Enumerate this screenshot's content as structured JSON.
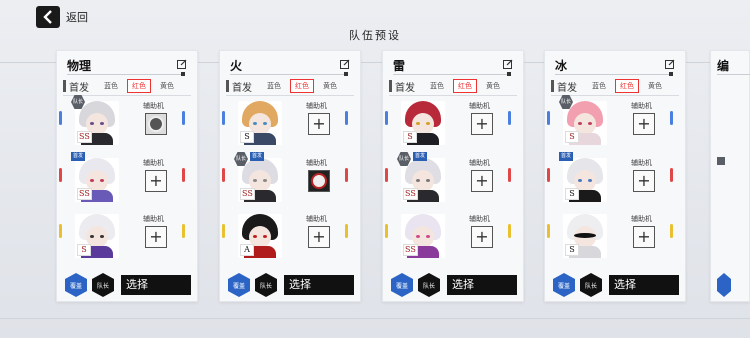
{
  "header": {
    "back_label": "返回",
    "title": "队伍预设"
  },
  "common": {
    "team_label": "首发",
    "support_label": "辅助机",
    "badge_leader": "队长",
    "badge_first": "首发"
  },
  "cards": [
    {
      "title": "物理",
      "tabs": [
        "蓝色",
        "红色",
        "黄色"
      ],
      "active_tab": 1,
      "bottom": {
        "overlay": "覆盖",
        "leader": "队长",
        "select": "选择"
      },
      "members": [
        {
          "rank": "SS",
          "support": "filled"
        },
        {
          "rank": "SS",
          "support": "empty"
        },
        {
          "rank": "S",
          "support": "empty"
        }
      ]
    },
    {
      "title": "火",
      "tabs": [
        "蓝色",
        "红色",
        "黄色"
      ],
      "active_tab": 1,
      "bottom": {
        "overlay": "覆盖",
        "leader": "队长",
        "select": "选择"
      },
      "members": [
        {
          "rank": "S",
          "support": "empty"
        },
        {
          "rank": "SS",
          "support": "filled-dark"
        },
        {
          "rank": "A",
          "support": "empty"
        }
      ]
    },
    {
      "title": "雷",
      "tabs": [
        "蓝色",
        "红色",
        "黄色"
      ],
      "active_tab": 1,
      "bottom": {
        "overlay": "覆盖",
        "leader": "队长",
        "select": "选择"
      },
      "members": [
        {
          "rank": "S",
          "support": "empty"
        },
        {
          "rank": "SS",
          "support": "empty"
        },
        {
          "rank": "SS",
          "support": "empty"
        }
      ]
    },
    {
      "title": "冰",
      "tabs": [
        "蓝色",
        "红色",
        "黄色"
      ],
      "active_tab": 1,
      "bottom": {
        "overlay": "覆盖",
        "leader": "队长",
        "select": "选择"
      },
      "members": [
        {
          "rank": "S",
          "support": "empty"
        },
        {
          "rank": "S",
          "support": "empty"
        },
        {
          "rank": "S",
          "support": "empty"
        }
      ]
    },
    {
      "title": "编"
    }
  ],
  "colors": {
    "tab_active": "#e33333",
    "overlay_button": "#2b64c5",
    "leader_button": "#111111"
  }
}
